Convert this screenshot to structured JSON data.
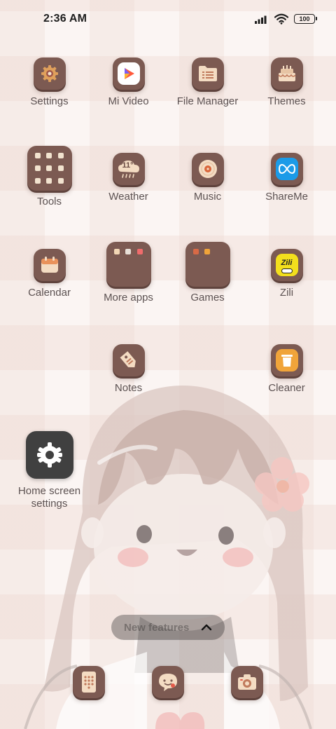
{
  "status_bar": {
    "time": "2:36 AM",
    "battery": "100",
    "icons": [
      "signal-icon",
      "wifi-icon",
      "battery-icon"
    ]
  },
  "apps": [
    {
      "label": "Settings",
      "icon": "settings-gear-icon"
    },
    {
      "label": "Mi Video",
      "icon": "mi-video-play-icon"
    },
    {
      "label": "File Manager",
      "icon": "folder-icon"
    },
    {
      "label": "Themes",
      "icon": "themes-cake-icon"
    },
    {
      "label": "Tools",
      "icon": "tools-folder-icon"
    },
    {
      "label": "Weather",
      "icon": "weather-cloud-icon",
      "temperature": "11°"
    },
    {
      "label": "Music",
      "icon": "music-disc-icon"
    },
    {
      "label": "ShareMe",
      "icon": "shareme-infinity-icon"
    },
    {
      "label": "Calendar",
      "icon": "calendar-icon"
    },
    {
      "label": "More apps",
      "icon": "more-apps-folder-icon"
    },
    {
      "label": "Games",
      "icon": "games-folder-icon"
    },
    {
      "label": "Zili",
      "icon": "zili-logo-icon",
      "logo_text": "Zili"
    },
    {
      "label": "Notes",
      "icon": "notes-tag-icon"
    },
    {
      "label": "Cleaner",
      "icon": "cleaner-bin-icon"
    }
  ],
  "home_screen_settings": {
    "label": "Home screen settings",
    "icon": "settings-gear-icon"
  },
  "new_features": {
    "label": "New features",
    "icon": "chevron-up-icon"
  },
  "dock": [
    {
      "name": "phone-dock-icon"
    },
    {
      "name": "messages-dock-icon"
    },
    {
      "name": "camera-dock-icon"
    }
  ],
  "colors": {
    "icon_bg": "#7c5a52",
    "icon_shadow": "#5f433d",
    "label": "#5c5252",
    "shareme_blue": "#1b9be8",
    "zili_yellow": "#f3df1d",
    "cleaner_orange": "#f0a43a"
  }
}
